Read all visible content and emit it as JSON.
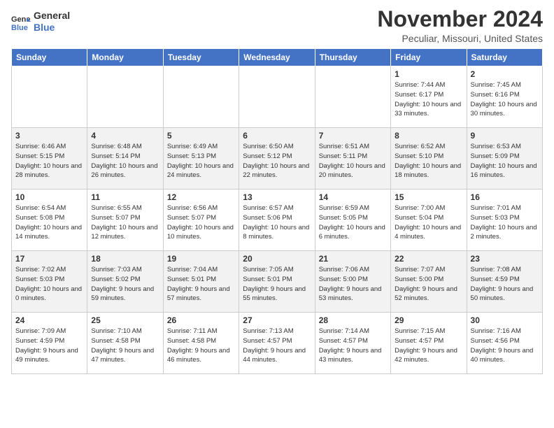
{
  "logo": {
    "line1": "General",
    "line2": "Blue"
  },
  "title": "November 2024",
  "location": "Peculiar, Missouri, United States",
  "days_of_week": [
    "Sunday",
    "Monday",
    "Tuesday",
    "Wednesday",
    "Thursday",
    "Friday",
    "Saturday"
  ],
  "weeks": [
    [
      {
        "day": "",
        "info": ""
      },
      {
        "day": "",
        "info": ""
      },
      {
        "day": "",
        "info": ""
      },
      {
        "day": "",
        "info": ""
      },
      {
        "day": "",
        "info": ""
      },
      {
        "day": "1",
        "info": "Sunrise: 7:44 AM\nSunset: 6:17 PM\nDaylight: 10 hours and 33 minutes."
      },
      {
        "day": "2",
        "info": "Sunrise: 7:45 AM\nSunset: 6:16 PM\nDaylight: 10 hours and 30 minutes."
      }
    ],
    [
      {
        "day": "3",
        "info": "Sunrise: 6:46 AM\nSunset: 5:15 PM\nDaylight: 10 hours and 28 minutes."
      },
      {
        "day": "4",
        "info": "Sunrise: 6:48 AM\nSunset: 5:14 PM\nDaylight: 10 hours and 26 minutes."
      },
      {
        "day": "5",
        "info": "Sunrise: 6:49 AM\nSunset: 5:13 PM\nDaylight: 10 hours and 24 minutes."
      },
      {
        "day": "6",
        "info": "Sunrise: 6:50 AM\nSunset: 5:12 PM\nDaylight: 10 hours and 22 minutes."
      },
      {
        "day": "7",
        "info": "Sunrise: 6:51 AM\nSunset: 5:11 PM\nDaylight: 10 hours and 20 minutes."
      },
      {
        "day": "8",
        "info": "Sunrise: 6:52 AM\nSunset: 5:10 PM\nDaylight: 10 hours and 18 minutes."
      },
      {
        "day": "9",
        "info": "Sunrise: 6:53 AM\nSunset: 5:09 PM\nDaylight: 10 hours and 16 minutes."
      }
    ],
    [
      {
        "day": "10",
        "info": "Sunrise: 6:54 AM\nSunset: 5:08 PM\nDaylight: 10 hours and 14 minutes."
      },
      {
        "day": "11",
        "info": "Sunrise: 6:55 AM\nSunset: 5:07 PM\nDaylight: 10 hours and 12 minutes."
      },
      {
        "day": "12",
        "info": "Sunrise: 6:56 AM\nSunset: 5:07 PM\nDaylight: 10 hours and 10 minutes."
      },
      {
        "day": "13",
        "info": "Sunrise: 6:57 AM\nSunset: 5:06 PM\nDaylight: 10 hours and 8 minutes."
      },
      {
        "day": "14",
        "info": "Sunrise: 6:59 AM\nSunset: 5:05 PM\nDaylight: 10 hours and 6 minutes."
      },
      {
        "day": "15",
        "info": "Sunrise: 7:00 AM\nSunset: 5:04 PM\nDaylight: 10 hours and 4 minutes."
      },
      {
        "day": "16",
        "info": "Sunrise: 7:01 AM\nSunset: 5:03 PM\nDaylight: 10 hours and 2 minutes."
      }
    ],
    [
      {
        "day": "17",
        "info": "Sunrise: 7:02 AM\nSunset: 5:03 PM\nDaylight: 10 hours and 0 minutes."
      },
      {
        "day": "18",
        "info": "Sunrise: 7:03 AM\nSunset: 5:02 PM\nDaylight: 9 hours and 59 minutes."
      },
      {
        "day": "19",
        "info": "Sunrise: 7:04 AM\nSunset: 5:01 PM\nDaylight: 9 hours and 57 minutes."
      },
      {
        "day": "20",
        "info": "Sunrise: 7:05 AM\nSunset: 5:01 PM\nDaylight: 9 hours and 55 minutes."
      },
      {
        "day": "21",
        "info": "Sunrise: 7:06 AM\nSunset: 5:00 PM\nDaylight: 9 hours and 53 minutes."
      },
      {
        "day": "22",
        "info": "Sunrise: 7:07 AM\nSunset: 5:00 PM\nDaylight: 9 hours and 52 minutes."
      },
      {
        "day": "23",
        "info": "Sunrise: 7:08 AM\nSunset: 4:59 PM\nDaylight: 9 hours and 50 minutes."
      }
    ],
    [
      {
        "day": "24",
        "info": "Sunrise: 7:09 AM\nSunset: 4:59 PM\nDaylight: 9 hours and 49 minutes."
      },
      {
        "day": "25",
        "info": "Sunrise: 7:10 AM\nSunset: 4:58 PM\nDaylight: 9 hours and 47 minutes."
      },
      {
        "day": "26",
        "info": "Sunrise: 7:11 AM\nSunset: 4:58 PM\nDaylight: 9 hours and 46 minutes."
      },
      {
        "day": "27",
        "info": "Sunrise: 7:13 AM\nSunset: 4:57 PM\nDaylight: 9 hours and 44 minutes."
      },
      {
        "day": "28",
        "info": "Sunrise: 7:14 AM\nSunset: 4:57 PM\nDaylight: 9 hours and 43 minutes."
      },
      {
        "day": "29",
        "info": "Sunrise: 7:15 AM\nSunset: 4:57 PM\nDaylight: 9 hours and 42 minutes."
      },
      {
        "day": "30",
        "info": "Sunrise: 7:16 AM\nSunset: 4:56 PM\nDaylight: 9 hours and 40 minutes."
      }
    ]
  ]
}
